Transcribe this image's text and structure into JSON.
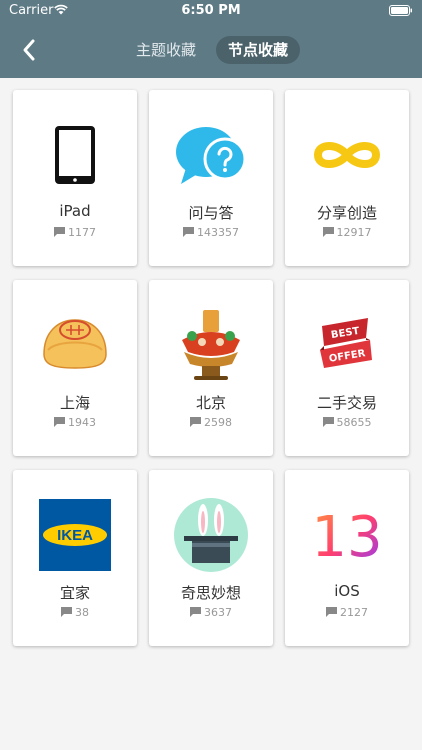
{
  "status_bar": {
    "carrier": "Carrier",
    "time": "6:50 PM"
  },
  "header": {
    "tabs": [
      {
        "label": "主题收藏"
      },
      {
        "label": "节点收藏"
      }
    ]
  },
  "nodes": [
    {
      "name": "iPad",
      "count": "1177",
      "icon": "ipad-icon"
    },
    {
      "name": "问与答",
      "count": "143357",
      "icon": "question-bubble-icon"
    },
    {
      "name": "分享创造",
      "count": "12917",
      "icon": "infinity-icon"
    },
    {
      "name": "上海",
      "count": "1943",
      "icon": "mooncake-icon"
    },
    {
      "name": "北京",
      "count": "2598",
      "icon": "hotpot-icon"
    },
    {
      "name": "二手交易",
      "count": "58655",
      "icon": "best-offer-ribbon-icon",
      "ribbon_text": [
        "BEST",
        "OFFER"
      ]
    },
    {
      "name": "宜家",
      "count": "38",
      "icon": "ikea-logo",
      "logo_text": "IKEA"
    },
    {
      "name": "奇思妙想",
      "count": "3637",
      "icon": "magic-hat-bunny-icon"
    },
    {
      "name": "iOS",
      "count": "2127",
      "icon": "ios13-logo",
      "logo_text": "13"
    }
  ],
  "colors": {
    "header": "#5e7a85",
    "active_tab": "#4b626b",
    "ios_bubble": "#2eb9ea",
    "infinity": "#f6c814",
    "ikea_blue": "#0058a3",
    "ikea_yellow": "#ffcc00"
  }
}
